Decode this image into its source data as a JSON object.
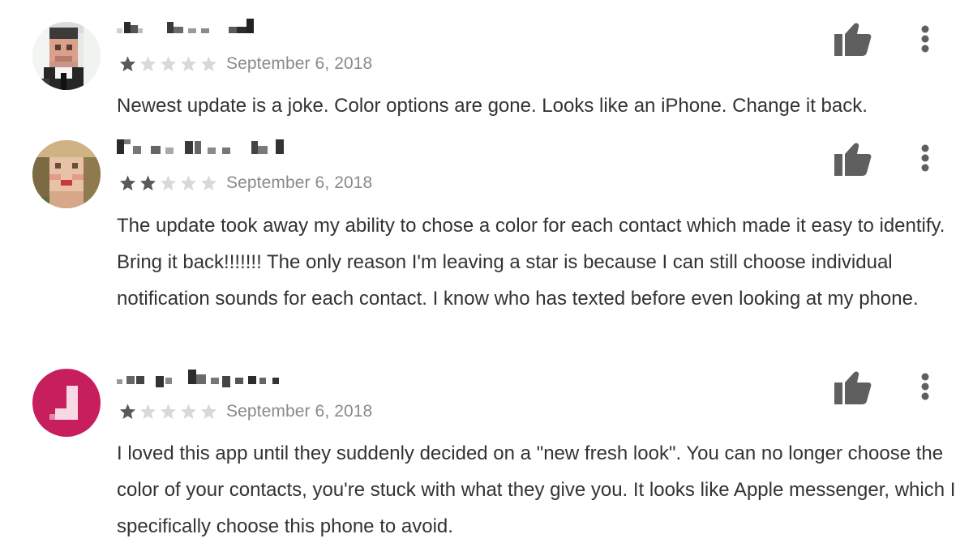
{
  "reviews": [
    {
      "rating": 1,
      "max_rating": 5,
      "date": "September 6, 2018",
      "text": "Newest update is a joke. Color options are gone. Looks like an iPhone. Change it back.",
      "avatar_type": "photo-pixelated-man"
    },
    {
      "rating": 2,
      "max_rating": 5,
      "date": "September 6, 2018",
      "text": "The update took away my ability to chose a color for each contact which made it easy to identify. Bring it back!!!!!!! The only reason I'm leaving a star is because I can still choose individual notification sounds for each contact. I know who has texted before even looking at my phone.",
      "avatar_type": "photo-pixelated-woman"
    },
    {
      "rating": 1,
      "max_rating": 5,
      "date": "September 6, 2018",
      "text": "I loved this app until they suddenly decided on a \"new fresh look\". You can no longer choose the color of your contacts, you're stuck with what they give you. It looks like Apple messenger, which I specifically choose this phone to avoid.",
      "avatar_type": "letter-pixelated",
      "avatar_color": "#c71f5e"
    }
  ],
  "icons": {
    "helpful": "thumb-up-icon",
    "more": "more-vert-icon",
    "star": "star-icon"
  },
  "colors": {
    "star_filled": "#595959",
    "star_empty": "#d9d9d9",
    "date": "#8a8a8a",
    "text": "#333333",
    "icon": "#5f5f5f"
  }
}
